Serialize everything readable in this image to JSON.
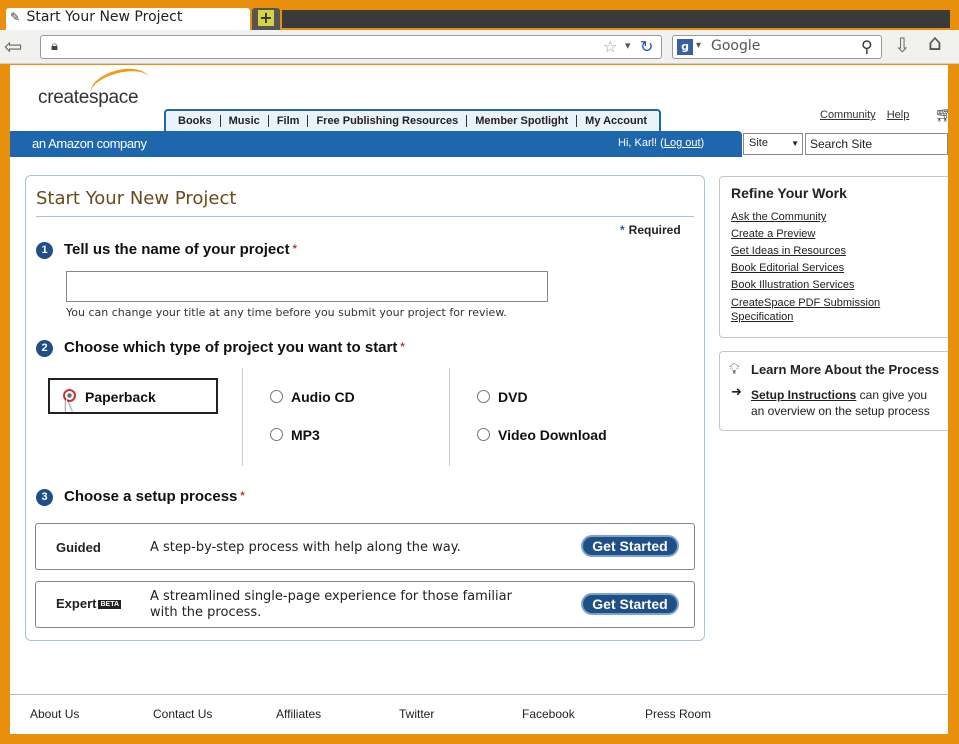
{
  "browser": {
    "tab_title": "Start Your New Project",
    "search_engine": "Google"
  },
  "header": {
    "logo_text_create": "create",
    "logo_text_space": "space",
    "amazon_tagline": "an Amazon company",
    "nav_tabs": [
      "Books",
      "Music",
      "Film",
      "Free Publishing Resources",
      "Member Spotlight",
      "My Account"
    ],
    "community_link": "Community",
    "help_link": "Help",
    "greeting": "Hi, Karl! (",
    "logout": "Log out",
    "greeting_end": ")",
    "site_select": "Site",
    "site_search_placeholder": "Search Site"
  },
  "main": {
    "title": "Start Your New Project",
    "required_label": "Required",
    "step1": {
      "num": "1",
      "label": "Tell us the name of your project",
      "hint": "You can change your title at any time before you submit your project for review.",
      "value": ""
    },
    "step2": {
      "num": "2",
      "label": "Choose which type of project you want to start",
      "options": [
        "Paperback",
        "Audio CD",
        "DVD",
        "MP3",
        "Video Download"
      ],
      "selected": "Paperback"
    },
    "step3": {
      "num": "3",
      "label": "Choose a setup process",
      "guided": {
        "name": "Guided",
        "desc": "A step-by-step process with help along the way.",
        "button": "Get Started"
      },
      "expert": {
        "name": "Expert",
        "badge": "BETA",
        "desc_line1": "A streamlined single-page experience for those familiar",
        "desc_line2": "with the process.",
        "button": "Get Started"
      }
    }
  },
  "refine": {
    "title": "Refine Your Work",
    "links": [
      "Ask the Community",
      "Create a Preview",
      "Get Ideas in Resources",
      "Book Editorial Services",
      "Book Illustration Services",
      "CreateSpace PDF Submission",
      "Specification"
    ]
  },
  "learn": {
    "title": "Learn More About the Process",
    "link": "Setup Instructions",
    "text_after_link": " can give you",
    "line2": "an overview on the setup process"
  },
  "footer": {
    "links": [
      "About Us",
      "Contact Us",
      "Affiliates",
      "Twitter",
      "Facebook",
      "Press Room"
    ]
  },
  "colors": {
    "brand_blue": "#1e67ad",
    "accent_orange": "#f39a1b",
    "frame_orange": "#e8900c"
  }
}
